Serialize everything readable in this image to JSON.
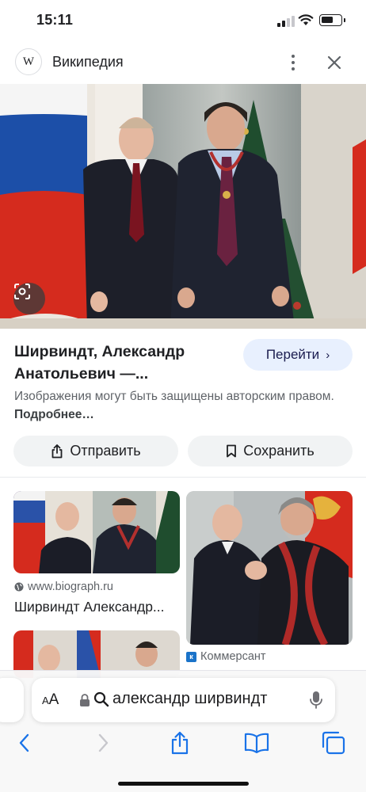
{
  "status_bar": {
    "time": "15:11"
  },
  "header": {
    "logo": "W",
    "site_name": "Википедия"
  },
  "result": {
    "title": "Ширвиндт, Александр Анатольевич —...",
    "go_button": "Перейти",
    "copyright_text": "Изображения могут быть защищены авторским правом.",
    "copyright_link": "Подробнее…",
    "share_button": "Отправить",
    "save_button": "Сохранить"
  },
  "related": [
    {
      "source": "www.biograph.ru",
      "title": "Ширвиндт Александр..."
    },
    {
      "source": "Коммерсант"
    }
  ],
  "browser": {
    "text_size_label": "AA",
    "query": "александр ширвиндт"
  },
  "colors": {
    "accent": "#1a73e8",
    "go_button_bg": "#e8f0fe",
    "chip_bg": "#f1f3f4"
  },
  "icons": [
    "wikipedia-logo",
    "more-vert-icon",
    "close-icon",
    "google-lens-icon",
    "chevron-right-icon",
    "share-icon",
    "bookmark-icon",
    "globe-icon",
    "kommersant-icon",
    "lock-icon",
    "search-icon",
    "mic-icon",
    "back-icon",
    "forward-icon",
    "share-icon",
    "bookmarks-icon",
    "tabs-icon"
  ]
}
